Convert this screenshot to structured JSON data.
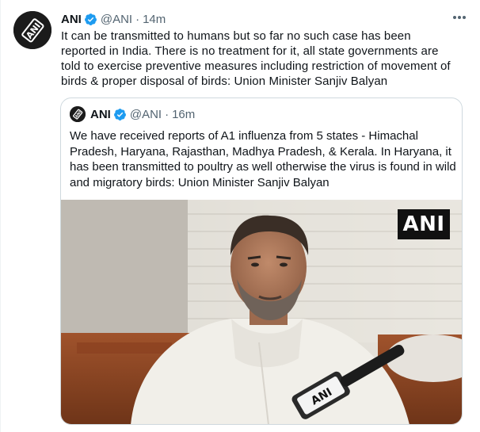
{
  "tweet": {
    "author_name": "ANI",
    "handle": "@ANI",
    "separator": "·",
    "time": "14m",
    "text": "It can be transmitted to humans but so far no such case has been reported in India. There is no treatment for it, all state governments are told to exercise preventive measures including restriction of movement of birds & proper disposal of birds: Union Minister Sanjiv Balyan"
  },
  "quoted_tweet": {
    "author_name": "ANI",
    "handle": "@ANI",
    "separator": "·",
    "time": "16m",
    "text": "We have received reports of A1 influenza from 5 states - Himachal Pradesh, Haryana, Rajasthan, Madhya Pradesh, & Kerala. In Haryana, it has been transmitted to poultry as well otherwise the virus is found in wild and migratory birds: Union Minister Sanjiv Balyan",
    "media": {
      "watermark": "ANI",
      "mic_label": "ANI"
    }
  },
  "colors": {
    "verified": "#1d9bf0",
    "secondary_text": "#536471",
    "border": "#cfd9de"
  },
  "icons": {
    "verified": "verified-badge-icon",
    "more": "more-options-icon"
  }
}
